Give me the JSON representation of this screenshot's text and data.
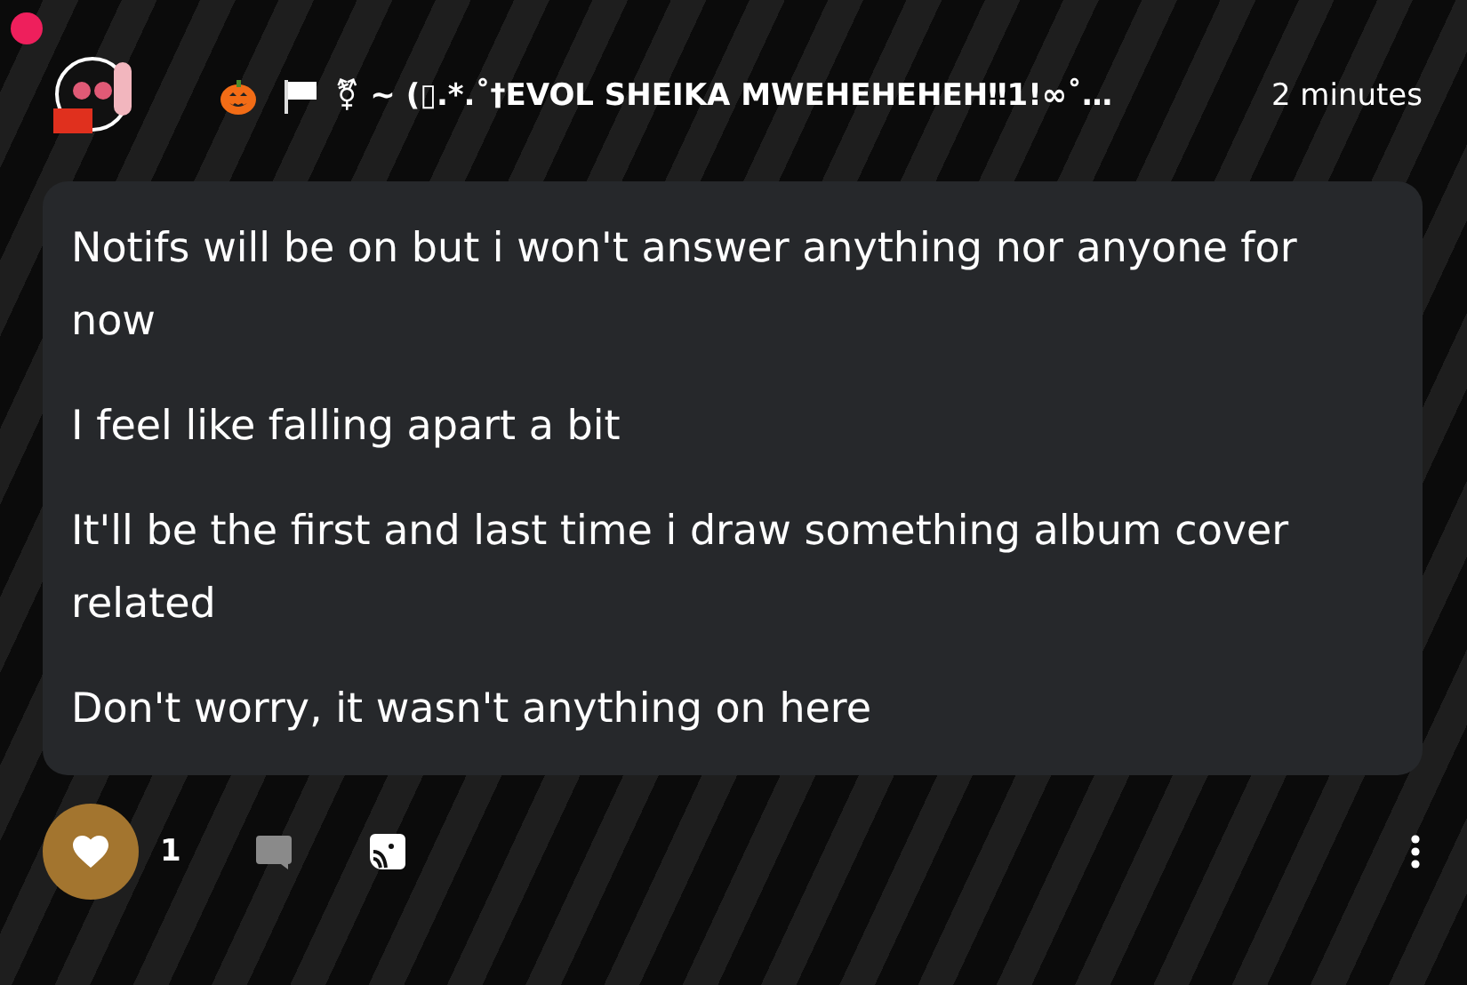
{
  "header": {
    "name": "⚧ ~ (▯.*.˚†EVOL SHEIKA MWEHEHEHEH‼1!∞˚…",
    "time": "2 minutes"
  },
  "post": {
    "paragraphs": [
      "Notifs will be on but i won't answer anything nor anyone for now",
      "I feel like falling apart a bit",
      "It'll be the first and last time i draw something album cover related",
      "Don't worry, it wasn't anything on here"
    ]
  },
  "actions": {
    "liked": true,
    "like_count": "1"
  }
}
